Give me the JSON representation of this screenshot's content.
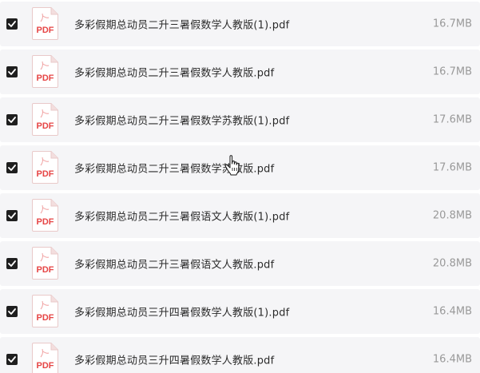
{
  "icon_label": "PDF",
  "colors": {
    "checkbox": "#1f1f1f",
    "pdf_red": "#e64545",
    "row_bg": "#f5f5f7",
    "size_text": "#999999"
  },
  "files": [
    {
      "name": "多彩假期总动员二升三暑假数学人教版(1).pdf",
      "size": "16.7MB",
      "checked": true
    },
    {
      "name": "多彩假期总动员二升三暑假数学人教版.pdf",
      "size": "16.7MB",
      "checked": true
    },
    {
      "name": "多彩假期总动员二升三暑假数学苏教版(1).pdf",
      "size": "17.6MB",
      "checked": true
    },
    {
      "name": "多彩假期总动员二升三暑假数学苏教版.pdf",
      "size": "17.6MB",
      "checked": true
    },
    {
      "name": "多彩假期总动员二升三暑假语文人教版(1).pdf",
      "size": "20.8MB",
      "checked": true
    },
    {
      "name": "多彩假期总动员二升三暑假语文人教版.pdf",
      "size": "20.8MB",
      "checked": true
    },
    {
      "name": "多彩假期总动员三升四暑假数学人教版(1).pdf",
      "size": "16.4MB",
      "checked": true
    },
    {
      "name": "多彩假期总动员三升四暑假数学人教版.pdf",
      "size": "16.4MB",
      "checked": true
    }
  ]
}
